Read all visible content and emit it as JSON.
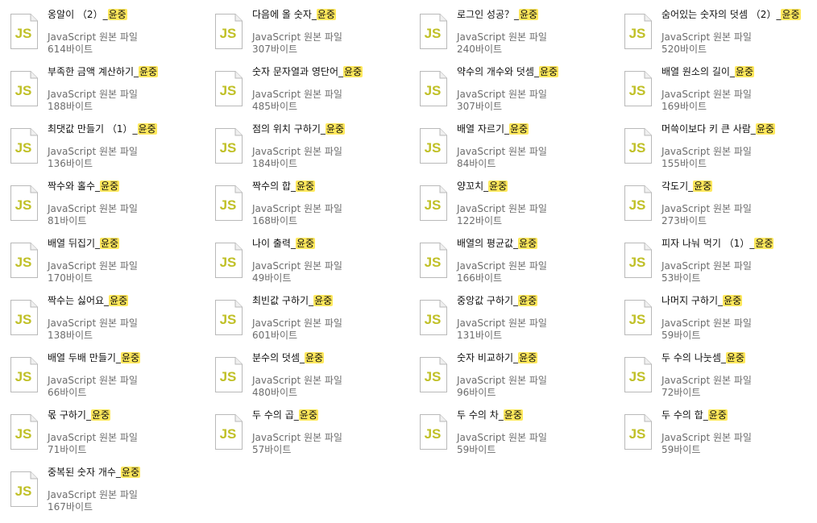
{
  "highlight_term": "윤중",
  "colors": {
    "highlight": "#ffe85c",
    "js_logo": "#c0c027",
    "meta_text": "#6d6d6d"
  },
  "icon_name": "javascript-file-icon",
  "files": [
    {
      "name_prefix": "옹알이 （2）_",
      "highlight": "윤중",
      "type": "JavaScript 원본 파일",
      "size": "614바이트"
    },
    {
      "name_prefix": "다음에 올 숫자_",
      "highlight": "윤중",
      "type": "JavaScript 원본 파일",
      "size": "307바이트"
    },
    {
      "name_prefix": "로그인 성공？_",
      "highlight": "윤중",
      "type": "JavaScript 원본 파일",
      "size": "240바이트"
    },
    {
      "name_prefix": "숨어있는 숫자의 덧셈 （2）_",
      "highlight": "윤중",
      "type": "JavaScript 원본 파일",
      "size": "520바이트"
    },
    {
      "name_prefix": "부족한 금액 계산하기_",
      "highlight": "윤중",
      "type": "JavaScript 원본 파일",
      "size": "188바이트"
    },
    {
      "name_prefix": "숫자 문자열과 영단어_",
      "highlight": "윤중",
      "type": "JavaScript 원본 파일",
      "size": "485바이트"
    },
    {
      "name_prefix": "약수의 개수와 덧셈_",
      "highlight": "윤중",
      "type": "JavaScript 원본 파일",
      "size": "307바이트"
    },
    {
      "name_prefix": "배열 원소의 길이_",
      "highlight": "윤중",
      "type": "JavaScript 원본 파일",
      "size": "169바이트"
    },
    {
      "name_prefix": "최댓값 만들기 （1）_",
      "highlight": "윤중",
      "type": "JavaScript 원본 파일",
      "size": "136바이트"
    },
    {
      "name_prefix": "점의 위치 구하기_",
      "highlight": "윤중",
      "type": "JavaScript 원본 파일",
      "size": "184바이트"
    },
    {
      "name_prefix": "배열 자르기_",
      "highlight": "윤중",
      "type": "JavaScript 원본 파일",
      "size": "84바이트"
    },
    {
      "name_prefix": "머쓱이보다 키 큰 사람_",
      "highlight": "윤중",
      "type": "JavaScript 원본 파일",
      "size": "155바이트"
    },
    {
      "name_prefix": "짝수와 홀수_",
      "highlight": "윤중",
      "type": "JavaScript 원본 파일",
      "size": "81바이트"
    },
    {
      "name_prefix": "짝수의 합_",
      "highlight": "윤중",
      "type": "JavaScript 원본 파일",
      "size": "168바이트"
    },
    {
      "name_prefix": "양꼬치_",
      "highlight": "윤중",
      "type": "JavaScript 원본 파일",
      "size": "122바이트"
    },
    {
      "name_prefix": "각도기_",
      "highlight": "윤중",
      "type": "JavaScript 원본 파일",
      "size": "273바이트"
    },
    {
      "name_prefix": "배열 뒤집기_",
      "highlight": "윤중",
      "type": "JavaScript 원본 파일",
      "size": "170바이트"
    },
    {
      "name_prefix": "나이 출력_",
      "highlight": "윤중",
      "type": "JavaScript 원본 파일",
      "size": "49바이트"
    },
    {
      "name_prefix": "배열의 평균값_",
      "highlight": "윤중",
      "type": "JavaScript 원본 파일",
      "size": "166바이트"
    },
    {
      "name_prefix": "피자 나눠 먹기 （1）_",
      "highlight": "윤중",
      "type": "JavaScript 원본 파일",
      "size": "53바이트"
    },
    {
      "name_prefix": "짝수는 싫어요_",
      "highlight": "윤중",
      "type": "JavaScript 원본 파일",
      "size": "138바이트"
    },
    {
      "name_prefix": "최빈값 구하기_",
      "highlight": "윤중",
      "type": "JavaScript 원본 파일",
      "size": "601바이트"
    },
    {
      "name_prefix": "중앙값 구하기_",
      "highlight": "윤중",
      "type": "JavaScript 원본 파일",
      "size": "131바이트"
    },
    {
      "name_prefix": "나머지 구하기_",
      "highlight": "윤중",
      "type": "JavaScript 원본 파일",
      "size": "59바이트"
    },
    {
      "name_prefix": "배열 두배 만들기_",
      "highlight": "윤중",
      "type": "JavaScript 원본 파일",
      "size": "66바이트"
    },
    {
      "name_prefix": "분수의 덧셈_",
      "highlight": "윤중",
      "type": "JavaScript 원본 파일",
      "size": "480바이트"
    },
    {
      "name_prefix": "숫자 비교하기_",
      "highlight": "윤중",
      "type": "JavaScript 원본 파일",
      "size": "96바이트"
    },
    {
      "name_prefix": "두 수의 나눗셈_",
      "highlight": "윤중",
      "type": "JavaScript 원본 파일",
      "size": "72바이트"
    },
    {
      "name_prefix": "몫 구하기_",
      "highlight": "윤중",
      "type": "JavaScript 원본 파일",
      "size": "71바이트"
    },
    {
      "name_prefix": "두 수의 곱_",
      "highlight": "윤중",
      "type": "JavaScript 원본 파일",
      "size": "57바이트"
    },
    {
      "name_prefix": "두 수의 차_",
      "highlight": "윤중",
      "type": "JavaScript 원본 파일",
      "size": "59바이트"
    },
    {
      "name_prefix": "두 수의 합_",
      "highlight": "윤중",
      "type": "JavaScript 원본 파일",
      "size": "59바이트"
    },
    {
      "name_prefix": "중복된 숫자 개수_",
      "highlight": "윤중",
      "type": "JavaScript 원본 파일",
      "size": "167바이트"
    }
  ]
}
